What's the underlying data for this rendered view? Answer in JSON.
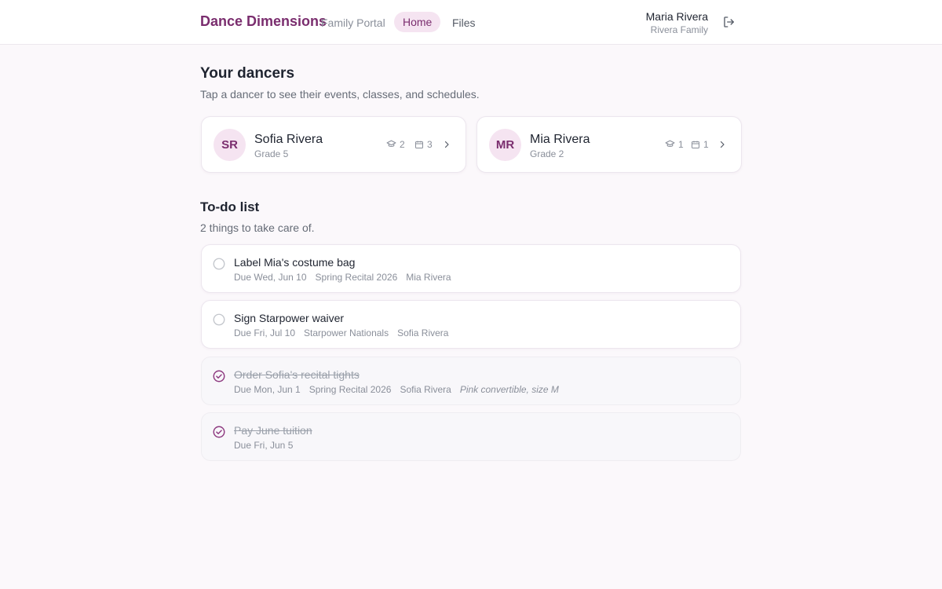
{
  "header": {
    "brand": "Dance Dimensions",
    "portal": "Family Portal",
    "nav": {
      "home": "Home",
      "files": "Files"
    },
    "user_name": "Maria Rivera",
    "user_family": "Rivera Family"
  },
  "dancers_section": {
    "title": "Your dancers",
    "subtitle": "Tap a dancer to see their events, classes, and schedules."
  },
  "dancers": [
    {
      "initials": "SR",
      "name": "Sofia Rivera",
      "grade": "Grade 5",
      "classes": "2",
      "events": "3"
    },
    {
      "initials": "MR",
      "name": "Mia Rivera",
      "grade": "Grade 2",
      "classes": "1",
      "events": "1"
    }
  ],
  "todo_section": {
    "title": "To-do list",
    "subtitle": "2 things to take care of."
  },
  "todos": [
    {
      "title": "Label Mia's costume bag",
      "due": "Due Wed, Jun 10",
      "event": "Spring Recital 2026",
      "dancer": "Mia Rivera",
      "note": "",
      "done": false
    },
    {
      "title": "Sign Starpower waiver",
      "due": "Due Fri, Jul 10",
      "event": "Starpower Nationals",
      "dancer": "Sofia Rivera",
      "note": "",
      "done": false
    },
    {
      "title": "Order Sofia's recital tights",
      "due": "Due Mon, Jun 1",
      "event": "Spring Recital 2026",
      "dancer": "Sofia Rivera",
      "note": "Pink convertible, size M",
      "done": true
    },
    {
      "title": "Pay June tuition",
      "due": "Due Fri, Jun 5",
      "event": "",
      "dancer": "",
      "note": "",
      "done": true
    }
  ],
  "colors": {
    "accent": "#7a2d6e",
    "accent_soft": "#f5e4f1"
  }
}
